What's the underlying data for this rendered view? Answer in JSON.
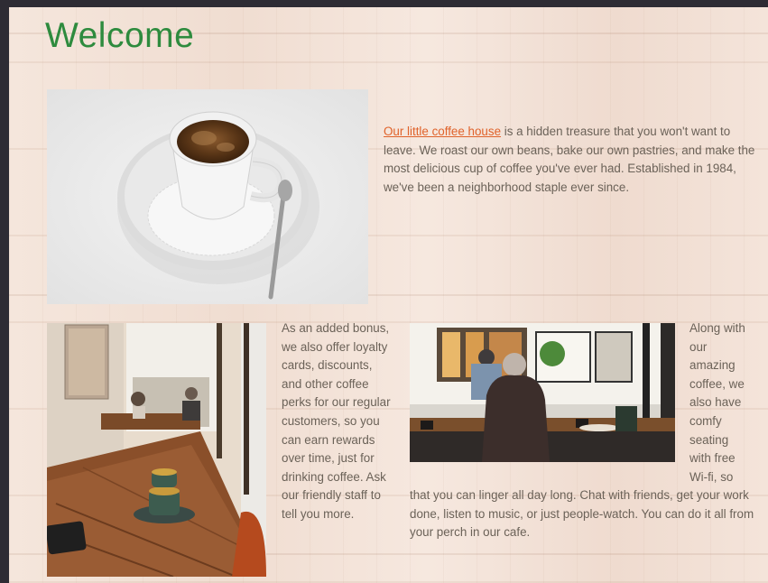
{
  "page": {
    "title": "Welcome"
  },
  "intro": {
    "link_text": "Our little coffee house",
    "text": " is a hidden treasure that you won't want to leave. We roast our own beans, bake our own pastries, and make the most delicious cup of coffee you've ever had. Established in 1984, we've been a neighborhood staple ever since."
  },
  "loyalty": {
    "text": "As an added bonus, we also offer loyalty cards, discounts, and other coffee perks for our regular customers, so you can earn rewards over time, just for drinking coffee. Ask our friendly staff to tell you more."
  },
  "seating": {
    "side_text": "Along with our amazing coffee, we also have comfy seating with free Wi-fi, so",
    "bottom_text": "that you can linger all day long. Chat with friends, get your work done, listen to music, or just people-watch. You can do it all from your perch in our cafe."
  },
  "colors": {
    "title": "#2e8b3e",
    "link": "#e0622a",
    "body_text": "#6b6258"
  }
}
